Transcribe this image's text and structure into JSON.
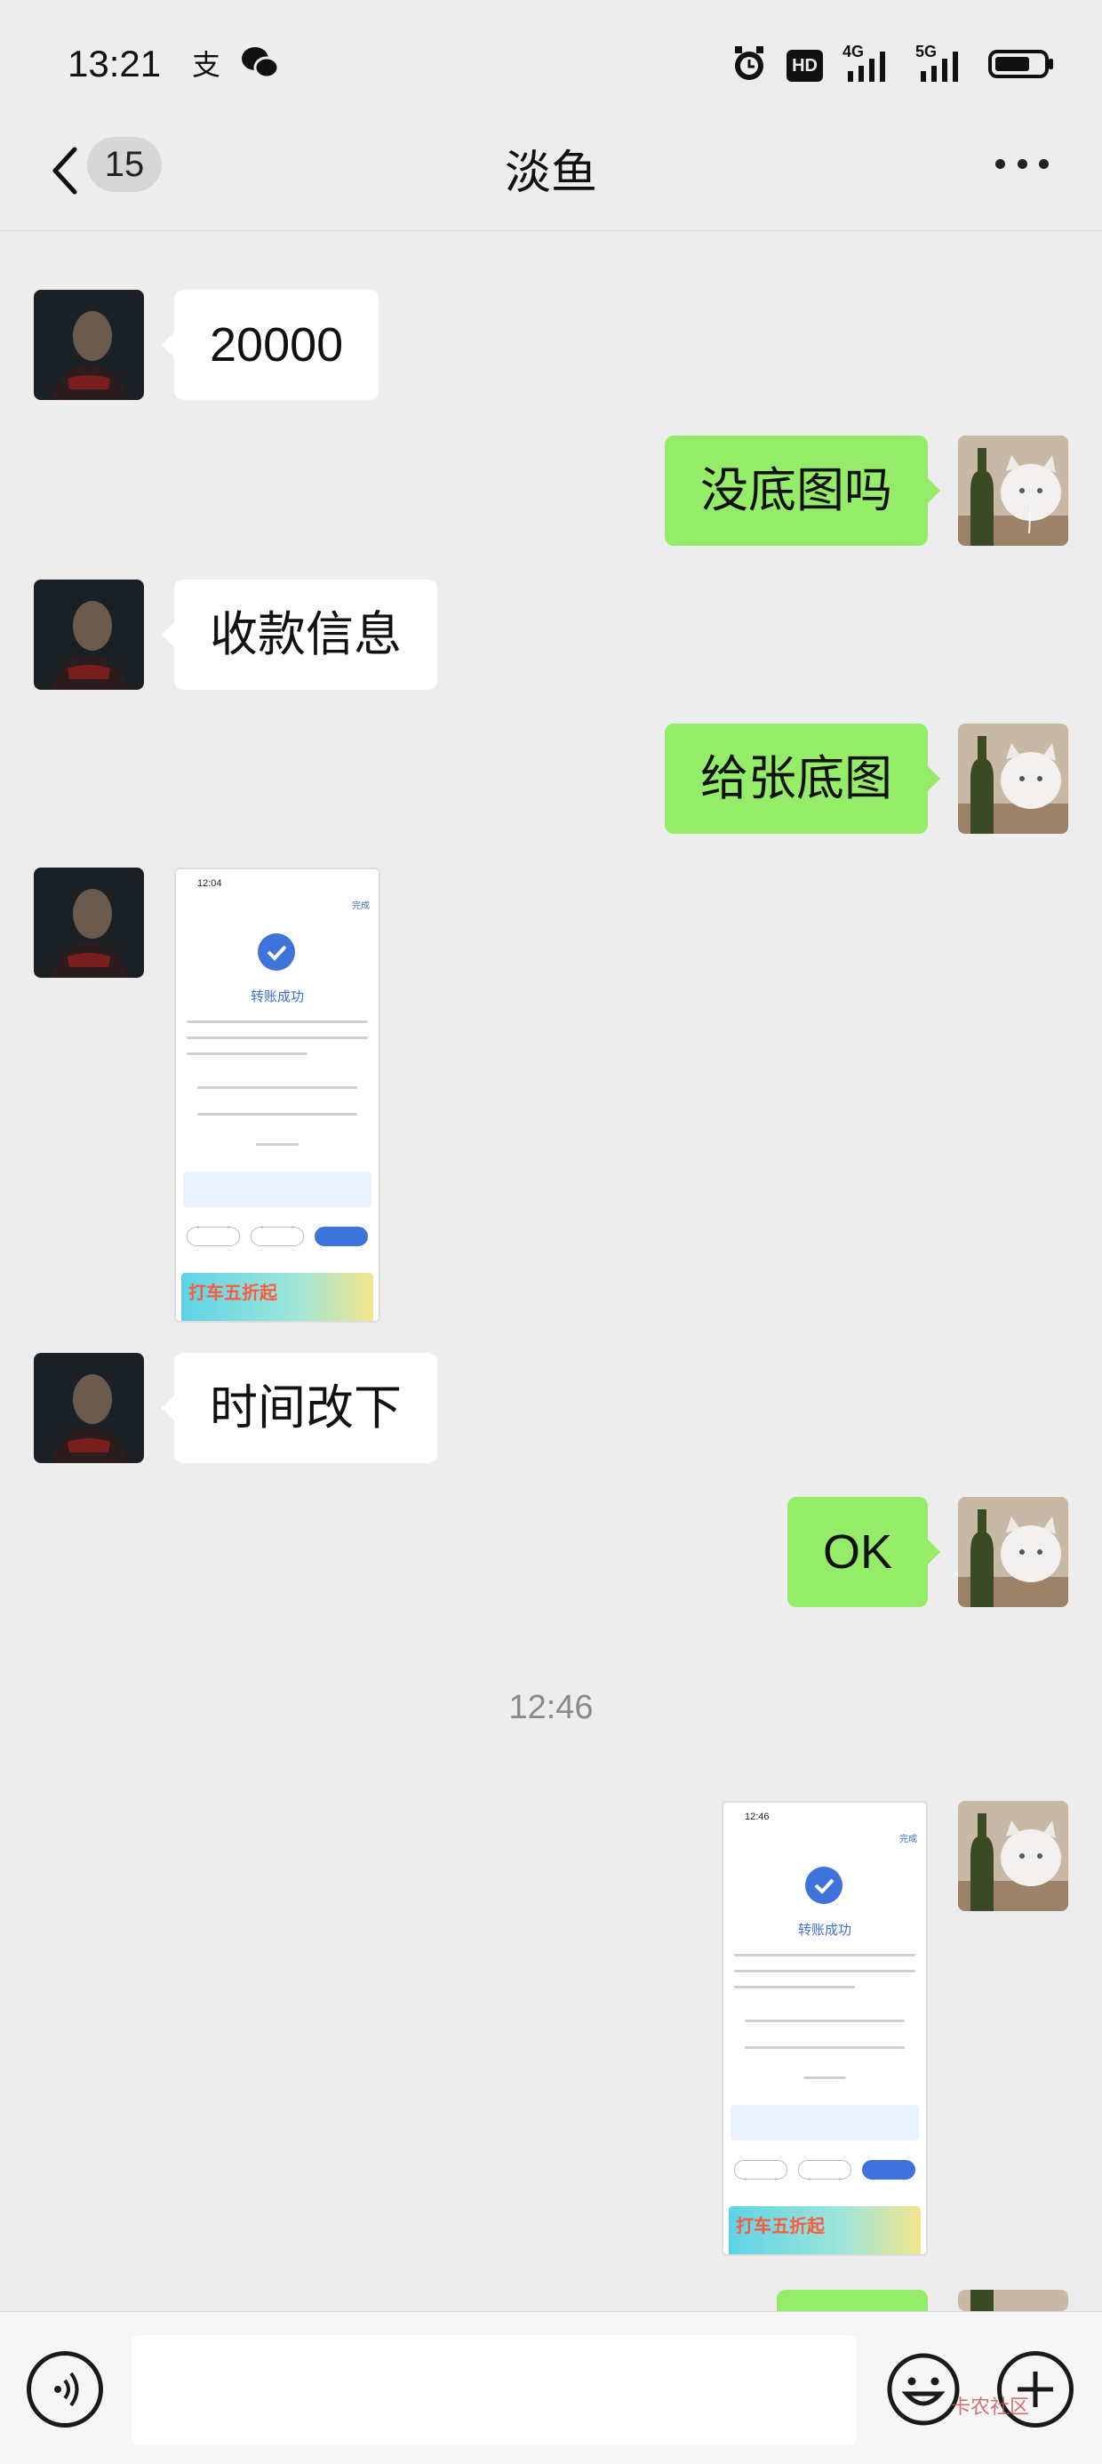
{
  "status_bar": {
    "time": "13:21",
    "app_icons": [
      "alipay-icon",
      "wechat-icon"
    ],
    "indicators": [
      "alarm-icon",
      "hd-icon",
      "signal-4g-icon",
      "signal-5g-icon",
      "battery-icon"
    ],
    "hd_label": "HD",
    "net_4g": "4G",
    "net_5g": "5G"
  },
  "nav": {
    "unread_count": "15",
    "title": "淡鱼"
  },
  "messages": [
    {
      "side": "in",
      "type": "text",
      "text": "20000"
    },
    {
      "side": "out",
      "type": "text",
      "text": "没底图吗"
    },
    {
      "side": "in",
      "type": "text",
      "text": "收款信息"
    },
    {
      "side": "out",
      "type": "text",
      "text": "给张底图"
    },
    {
      "side": "in",
      "type": "image",
      "thumb": {
        "time": "12:04",
        "done": "完成",
        "title": "转账成功",
        "banner": "打车五折起"
      }
    },
    {
      "side": "in",
      "type": "text",
      "text": "时间改下"
    },
    {
      "side": "out",
      "type": "text",
      "text": "OK"
    },
    {
      "type": "timestamp",
      "text": "12:46"
    },
    {
      "side": "out",
      "type": "image",
      "thumb": {
        "time": "12:46",
        "done": "完成",
        "title": "转账成功",
        "banner": "打车五折起"
      }
    }
  ],
  "input_bar": {
    "placeholder": ""
  },
  "watermark": "卡农社区",
  "colors": {
    "background": "#ededed",
    "outgoing_bubble": "#95ec69",
    "incoming_bubble": "#ffffff"
  }
}
